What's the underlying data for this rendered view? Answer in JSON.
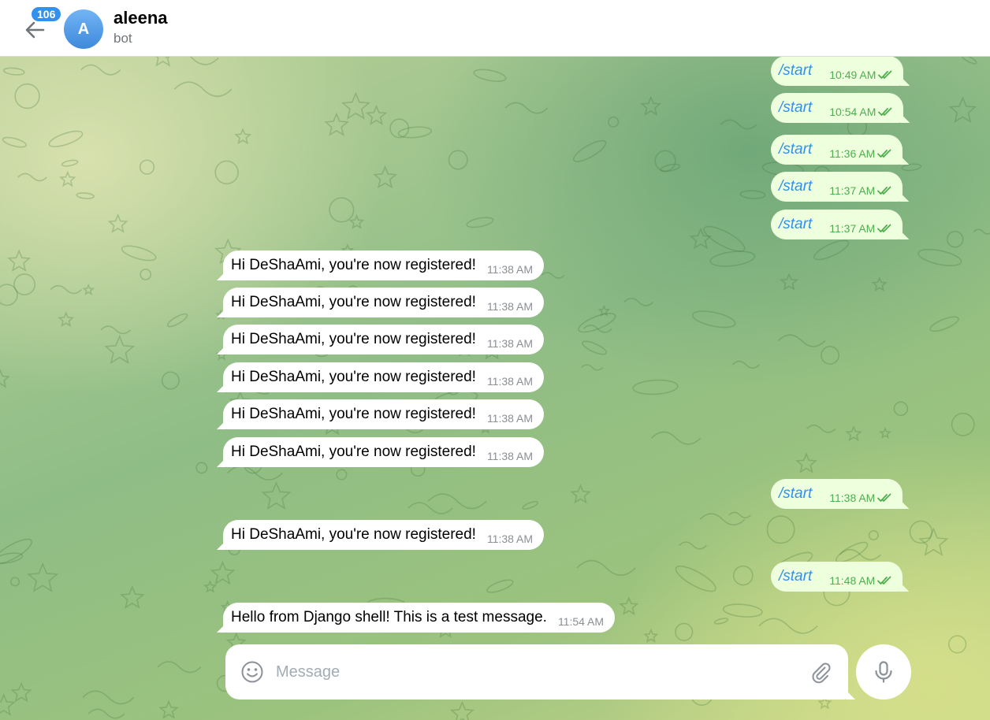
{
  "header": {
    "unread_count": "106",
    "avatar_initial": "A",
    "title": "aleena",
    "status": "bot"
  },
  "messages": [
    {
      "direction": "out",
      "text": "/start",
      "time": "10:49 AM",
      "read": true
    },
    {
      "direction": "out",
      "text": "/start",
      "time": "10:54 AM",
      "read": true
    },
    {
      "direction": "out",
      "text": "/start",
      "time": "11:36 AM",
      "read": true
    },
    {
      "direction": "out",
      "text": "/start",
      "time": "11:37 AM",
      "read": true
    },
    {
      "direction": "out",
      "text": "/start",
      "time": "11:37 AM",
      "read": true
    },
    {
      "direction": "in",
      "text": "Hi DeShaAmi, you're now registered!",
      "time": "11:38 AM"
    },
    {
      "direction": "in",
      "text": "Hi DeShaAmi, you're now registered!",
      "time": "11:38 AM"
    },
    {
      "direction": "in",
      "text": "Hi DeShaAmi, you're now registered!",
      "time": "11:38 AM"
    },
    {
      "direction": "in",
      "text": "Hi DeShaAmi, you're now registered!",
      "time": "11:38 AM"
    },
    {
      "direction": "in",
      "text": "Hi DeShaAmi, you're now registered!",
      "time": "11:38 AM"
    },
    {
      "direction": "in",
      "text": "Hi DeShaAmi, you're now registered!",
      "time": "11:38 AM"
    },
    {
      "direction": "out",
      "text": "/start",
      "time": "11:38 AM",
      "read": true
    },
    {
      "direction": "in",
      "text": "Hi DeShaAmi, you're now registered!",
      "time": "11:38 AM"
    },
    {
      "direction": "out",
      "text": "/start",
      "time": "11:48 AM",
      "read": true
    },
    {
      "direction": "in",
      "text": "Hello from Django shell! This is a test message.",
      "time": "11:54 AM"
    }
  ],
  "composer": {
    "placeholder": "Message",
    "value": ""
  },
  "icons": {
    "back": "arrow-left-icon",
    "emoji": "smile-icon",
    "attach": "paperclip-icon",
    "mic": "microphone-icon",
    "read_receipt": "double-check-icon"
  },
  "colors": {
    "accent": "#3390ec",
    "outgoing_bubble": "#eeffde",
    "read_check": "#4fae4e"
  }
}
